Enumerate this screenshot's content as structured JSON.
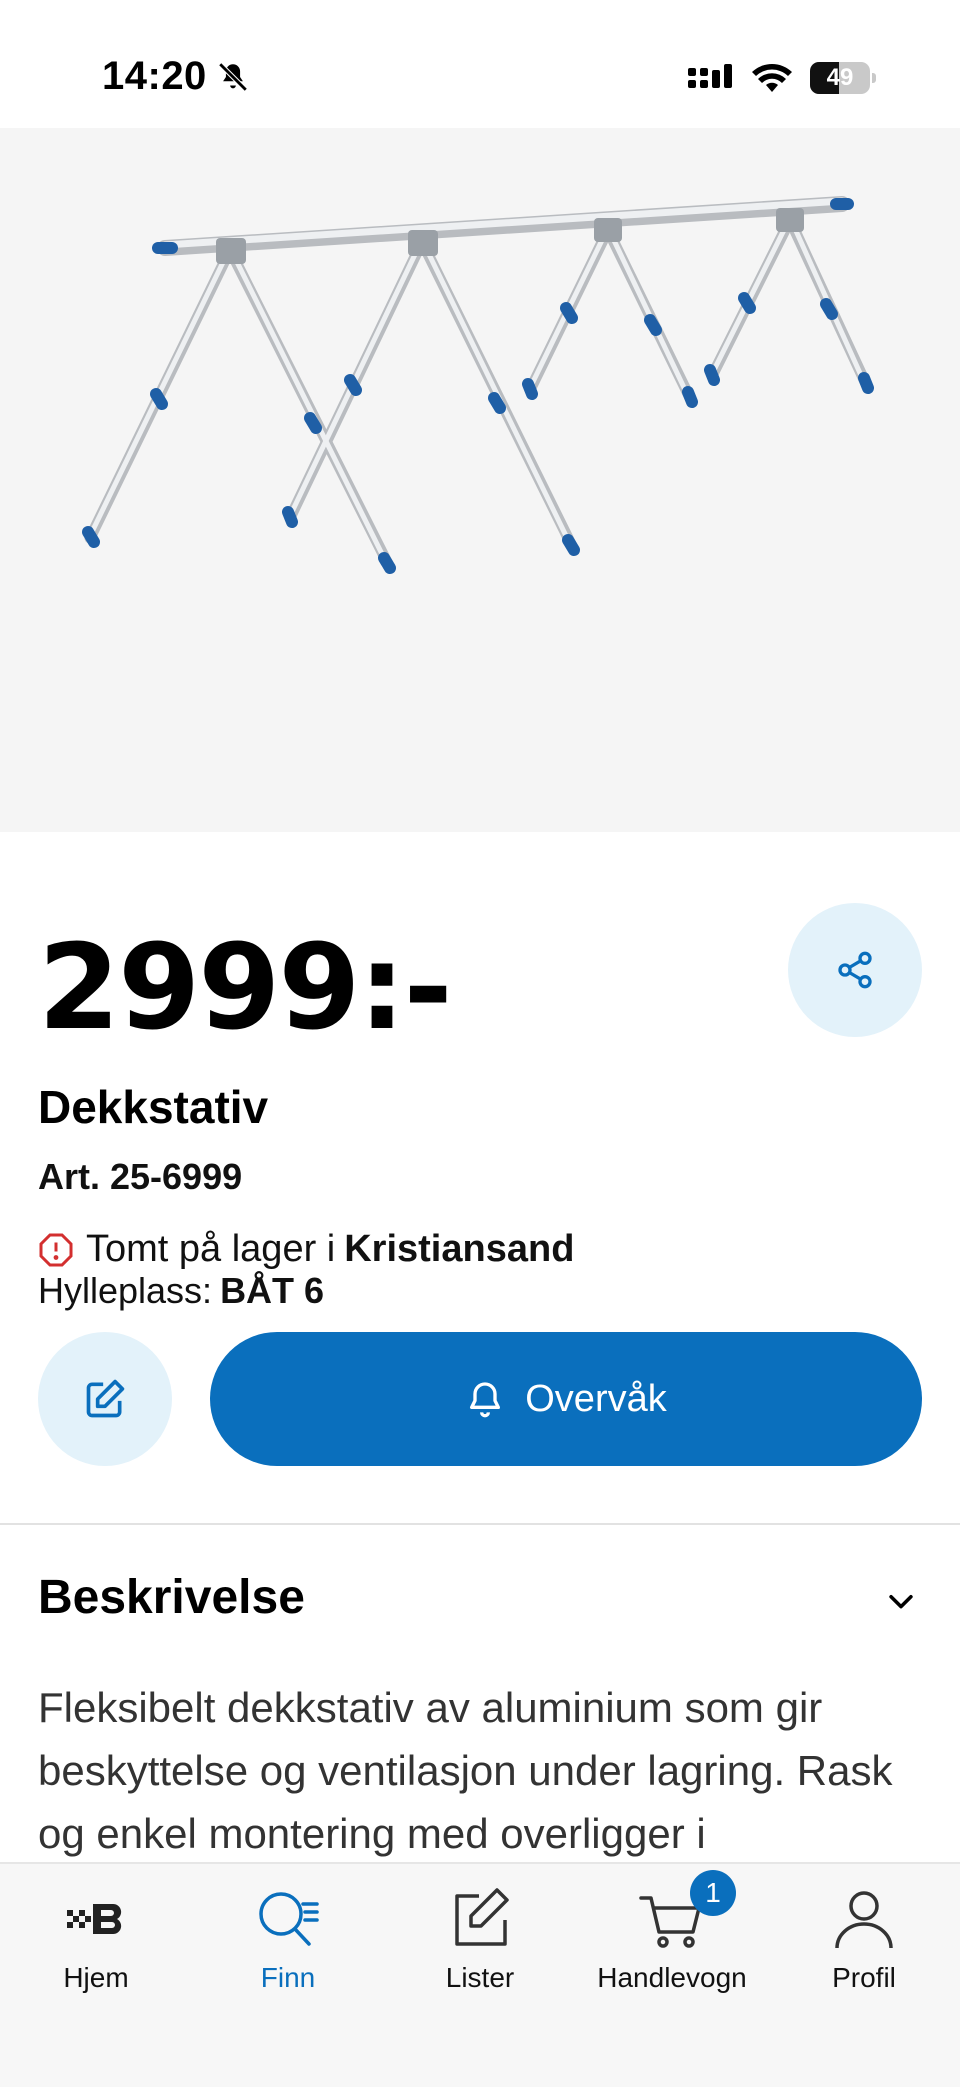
{
  "status_bar": {
    "time": "14:20",
    "battery_level": "49"
  },
  "product": {
    "price": "2999:-",
    "title": "Dekkstativ",
    "article_number": "Art. 25-6999",
    "stock_status_prefix": "Tomt på lager i",
    "stock_location": "Kristiansand",
    "shelf_label": "Hylleplass:",
    "shelf_value": "BÅT 6"
  },
  "actions": {
    "watch_label": "Overvåk"
  },
  "description": {
    "heading": "Beskrivelse",
    "text": "Fleksibelt dekkstativ av aluminium som gir beskyttelse og ventilasjon under lagring. Rask og enkel montering med overligger i"
  },
  "bottom_nav": {
    "items": [
      {
        "label": "Hjem",
        "icon": "biltema-logo-icon"
      },
      {
        "label": "Finn",
        "icon": "search-list-icon",
        "active": true
      },
      {
        "label": "Lister",
        "icon": "edit-list-icon"
      },
      {
        "label": "Handlevogn",
        "icon": "cart-icon",
        "badge": "1"
      },
      {
        "label": "Profil",
        "icon": "user-icon"
      }
    ]
  },
  "colors": {
    "accent": "#0a6fbd",
    "accent_light": "#e3f2fa",
    "warning": "#d32f2f"
  }
}
